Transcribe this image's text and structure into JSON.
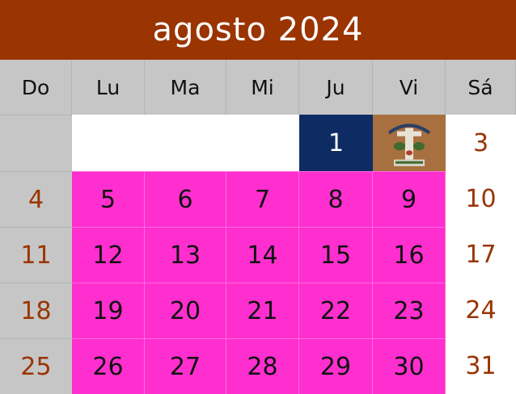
{
  "calendar": {
    "title": "agosto 2024",
    "weekdays": [
      "Do",
      "Lu",
      "Ma",
      "Mi",
      "Ju",
      "Vi",
      "Sá"
    ],
    "days": {
      "d1": "1",
      "d3": "3",
      "d4": "4",
      "d5": "5",
      "d6": "6",
      "d7": "7",
      "d8": "8",
      "d9": "9",
      "d10": "10",
      "d11": "11",
      "d12": "12",
      "d13": "13",
      "d14": "14",
      "d15": "15",
      "d16": "16",
      "d17": "17",
      "d18": "18",
      "d19": "19",
      "d20": "20",
      "d21": "21",
      "d22": "22",
      "d23": "23",
      "d24": "24",
      "d25": "25",
      "d26": "26",
      "d27": "27",
      "d28": "28",
      "d29": "29",
      "d30": "30",
      "d31": "31"
    }
  },
  "colors": {
    "title_bar": "#9a3400",
    "header_row": "#c6c6c6",
    "weekday_cells": "#ff2fcf",
    "highlight_day": "#0e2b63",
    "weekend_text": "#9a3400"
  },
  "icons": {
    "day2_image": "emblem-icon"
  }
}
